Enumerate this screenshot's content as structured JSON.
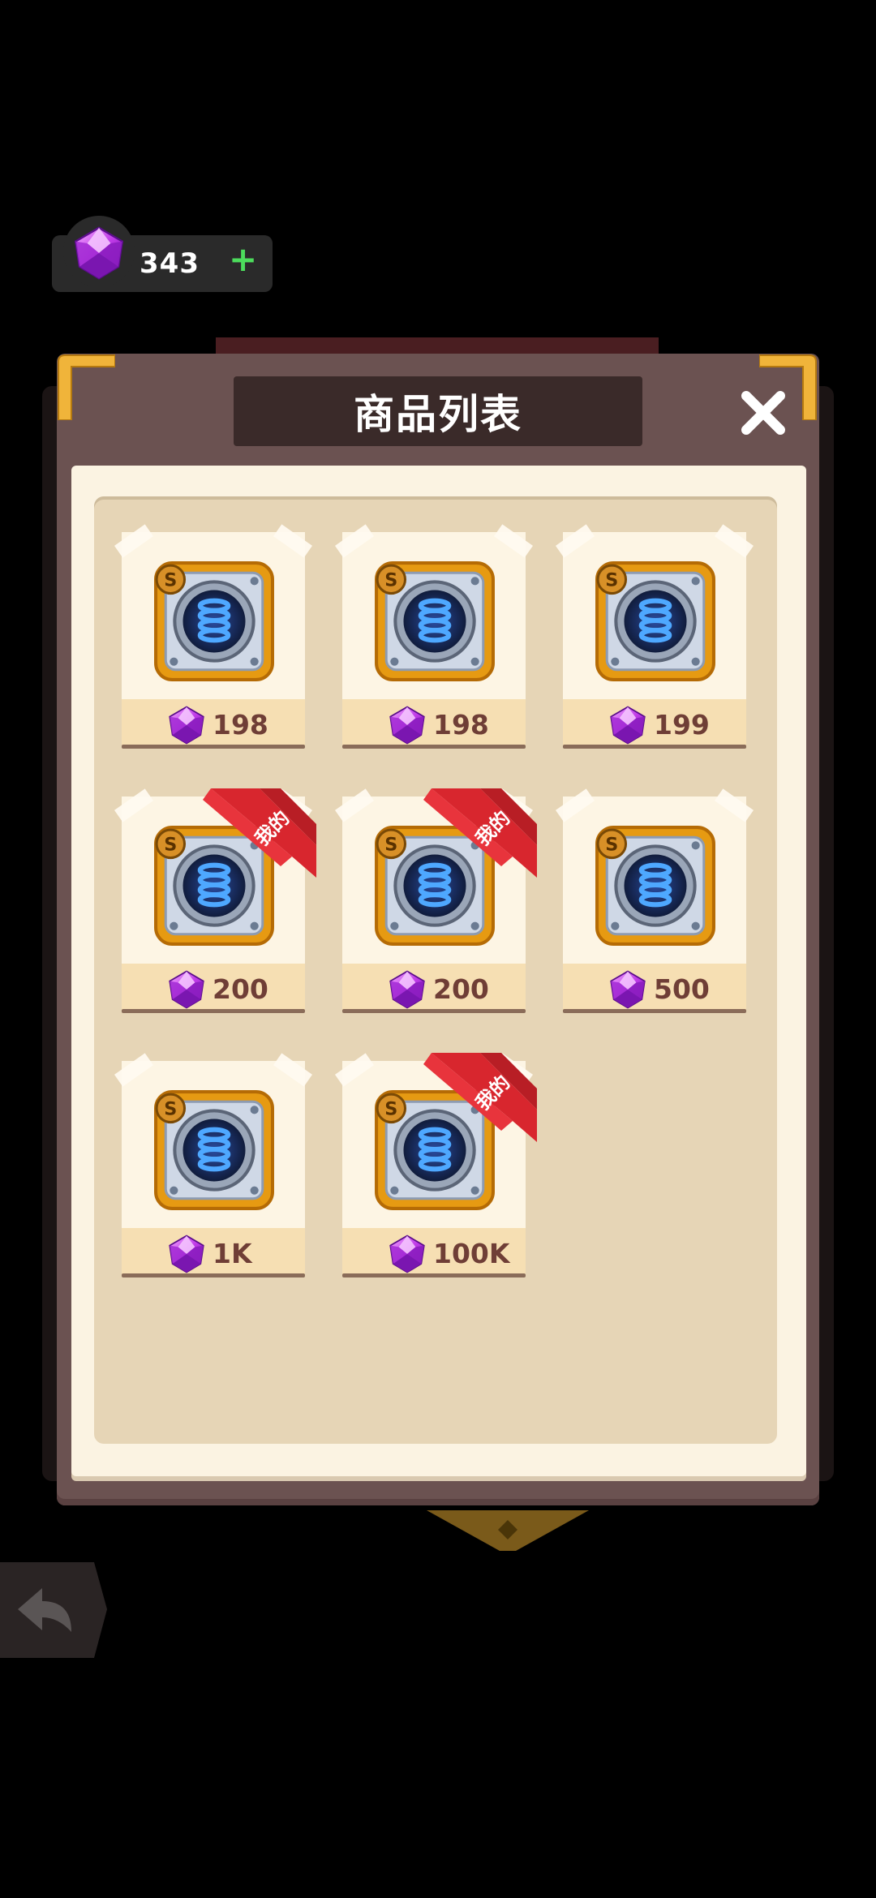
{
  "currency": {
    "amount": "343",
    "plus": "+"
  },
  "dialog": {
    "title": "商品列表",
    "close": "✕"
  },
  "items": [
    {
      "price": "198",
      "owned": false
    },
    {
      "price": "198",
      "owned": false
    },
    {
      "price": "199",
      "owned": false
    },
    {
      "price": "200",
      "owned": true,
      "badge": "我的"
    },
    {
      "price": "200",
      "owned": true,
      "badge": "我的"
    },
    {
      "price": "500",
      "owned": false
    },
    {
      "price": "1K",
      "owned": false
    },
    {
      "price": "100K",
      "owned": true,
      "badge": "我的"
    }
  ],
  "icons": {
    "currency": "gem-icon",
    "item": "spring-item-icon",
    "back": "back-arrow-icon",
    "close": "close-icon"
  },
  "colors": {
    "gem": "#b532e0",
    "ribbon": "#d8262e",
    "panel_border": "#6b5251",
    "price_text": "#6f3e36",
    "plus": "#4cdc5c"
  }
}
